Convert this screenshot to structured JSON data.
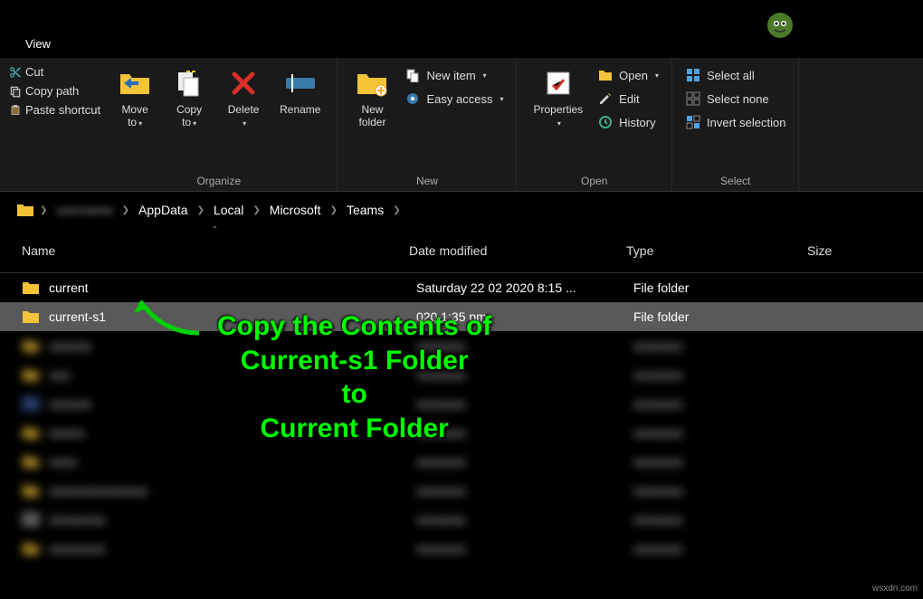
{
  "tab": {
    "view": "View"
  },
  "clipboard": {
    "cut": "Cut",
    "copy_path": "Copy path",
    "paste_shortcut": "Paste shortcut"
  },
  "organize": {
    "move_to": "Move\nto",
    "copy_to": "Copy\nto",
    "delete": "Delete",
    "rename": "Rename",
    "label": "Organize"
  },
  "new": {
    "new_folder": "New\nfolder",
    "new_item": "New item",
    "easy_access": "Easy access",
    "label": "New"
  },
  "open": {
    "properties": "Properties",
    "open": "Open",
    "edit": "Edit",
    "history": "History",
    "label": "Open"
  },
  "select": {
    "select_all": "Select all",
    "select_none": "Select none",
    "invert": "Invert selection",
    "label": "Select"
  },
  "breadcrumb": {
    "items": [
      "AppData",
      "Local",
      "Microsoft",
      "Teams"
    ]
  },
  "columns": {
    "name": "Name",
    "date": "Date modified",
    "type": "Type",
    "size": "Size"
  },
  "rows": [
    {
      "name": "current",
      "date": "Saturday 22 02 2020 8:15 ...",
      "type": "File folder",
      "size": ""
    },
    {
      "name": "current-s1",
      "date": "020 1:35 pm",
      "type": "File folder",
      "size": ""
    }
  ],
  "annotation": {
    "line1": "Copy the Contents of",
    "line2": "Current-s1 Folder",
    "line3": "to",
    "line4": "Current Folder"
  },
  "watermark": "wsxdn.com"
}
